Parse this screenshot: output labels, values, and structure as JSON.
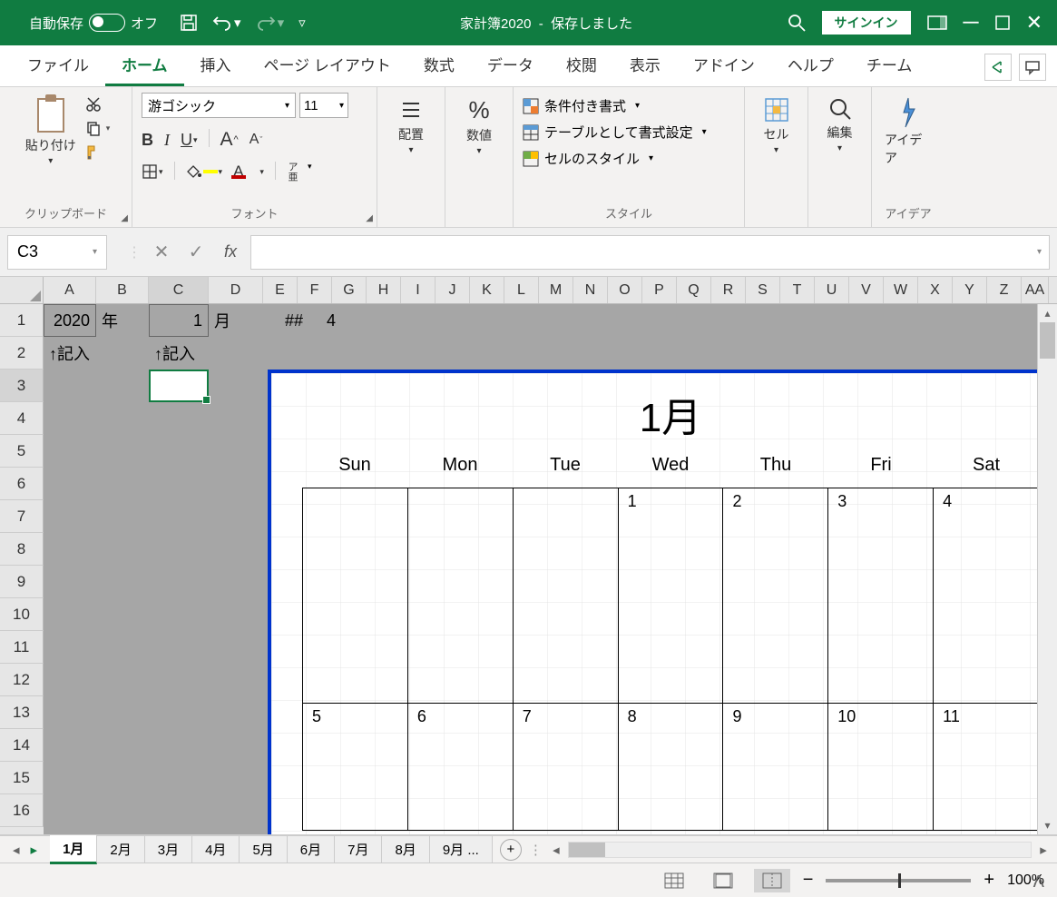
{
  "title": {
    "auto_save": "自動保存",
    "toggle_state": "オフ",
    "file_name": "家計簿2020",
    "status": "保存しました",
    "signin": "サインイン"
  },
  "tabs": {
    "file": "ファイル",
    "home": "ホーム",
    "insert": "挿入",
    "page_layout": "ページ レイアウト",
    "formulas": "数式",
    "data": "データ",
    "review": "校閲",
    "view": "表示",
    "addins": "アドイン",
    "help": "ヘルプ",
    "team": "チーム"
  },
  "ribbon": {
    "clipboard": {
      "paste": "貼り付け",
      "label": "クリップボード"
    },
    "font": {
      "family": "游ゴシック",
      "size": "11",
      "label": "フォント",
      "abc": "ア亜"
    },
    "alignment": {
      "label": "配置"
    },
    "number": {
      "label": "数値"
    },
    "styles": {
      "cond_format": "条件付き書式",
      "table_format": "テーブルとして書式設定",
      "cell_styles": "セルのスタイル",
      "label": "スタイル"
    },
    "cells": {
      "label": "セル"
    },
    "editing": {
      "label": "編集"
    },
    "ideas": {
      "label": "アイデア",
      "btn": "アイデア"
    }
  },
  "formula": {
    "name_box": "C3"
  },
  "cols": [
    "A",
    "B",
    "C",
    "D",
    "E",
    "F",
    "G",
    "H",
    "I",
    "J",
    "K",
    "L",
    "M",
    "N",
    "O",
    "P",
    "Q",
    "R",
    "S",
    "T",
    "U",
    "V",
    "W",
    "X",
    "Y",
    "Z",
    "AA"
  ],
  "rows": [
    "1",
    "2",
    "3",
    "4",
    "5",
    "6",
    "7",
    "8",
    "9",
    "10",
    "11",
    "12",
    "13",
    "14",
    "15",
    "16"
  ],
  "cells": {
    "A1": "2020",
    "B1": "年",
    "C1": "1",
    "D1": "月",
    "F1": "##",
    "G1": "4",
    "A2": "↑記入",
    "C2": "↑記入"
  },
  "calendar": {
    "title": "1月",
    "days": [
      "Sun",
      "Mon",
      "Tue",
      "Wed",
      "Thu",
      "Fri",
      "Sat"
    ],
    "week1": [
      "",
      "",
      "",
      "1",
      "2",
      "3",
      "4"
    ],
    "week2": [
      "5",
      "6",
      "7",
      "8",
      "9",
      "10",
      "11"
    ]
  },
  "sheet_tabs": [
    "1月",
    "2月",
    "3月",
    "4月",
    "5月",
    "6月",
    "7月",
    "8月",
    "9月 ..."
  ],
  "zoom": "100%"
}
